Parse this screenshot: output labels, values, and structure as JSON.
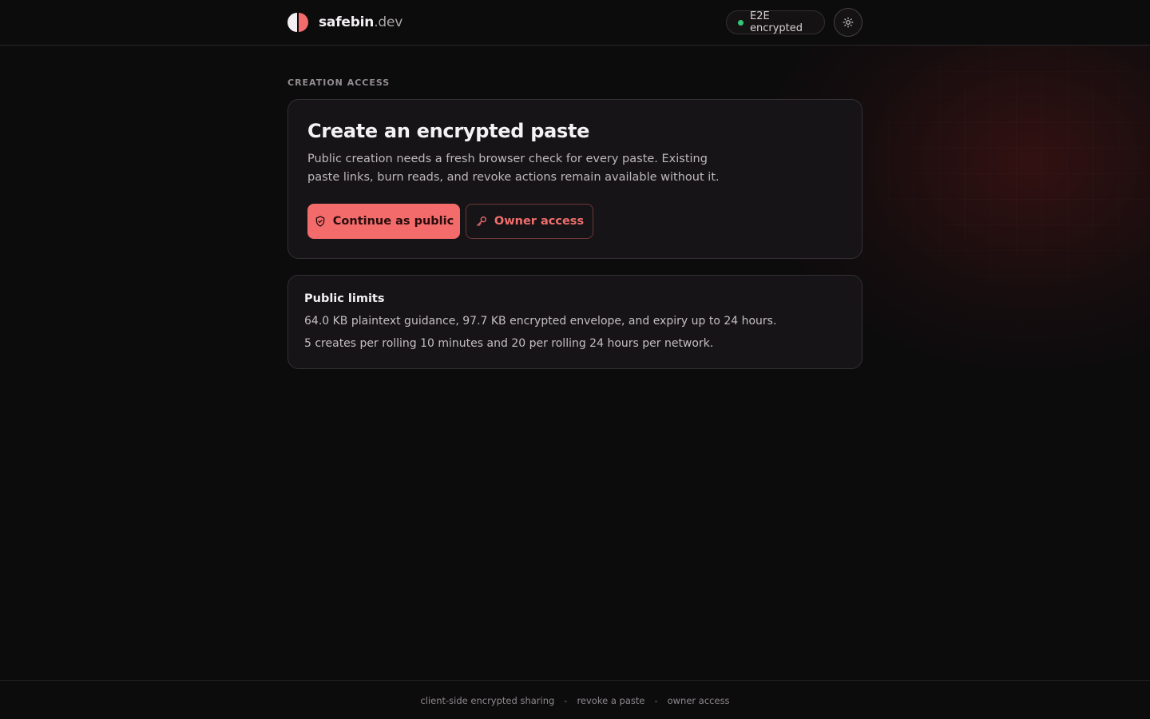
{
  "colors": {
    "background": "#0d0c0d",
    "accent": "#f36b6b",
    "status_ok": "#34c77b",
    "card": "#161416"
  },
  "header": {
    "brand_name": "safebin",
    "brand_tld": ".dev",
    "logo_icon": "half-circle-logo-icon",
    "badge_label": "E2E encrypted",
    "theme_toggle_icon": "sun-icon"
  },
  "main": {
    "section_label": "CREATION ACCESS",
    "create_card": {
      "title": "Create an encrypted paste",
      "description": "Public creation needs a fresh browser check for every paste. Existing paste links, burn reads, and revoke actions remain available without it.",
      "primary_button": {
        "label": "Continue as public",
        "icon": "shield-check-icon"
      },
      "secondary_button": {
        "label": "Owner access",
        "icon": "key-icon"
      }
    },
    "limits_card": {
      "title": "Public limits",
      "lines": [
        "64.0 KB plaintext guidance, 97.7 KB encrypted envelope, and expiry up to 24 hours.",
        "5 creates per rolling 10 minutes and 20 per rolling 24 hours per network."
      ]
    }
  },
  "footer": {
    "links": [
      "client-side encrypted sharing",
      "revoke a paste",
      "owner access"
    ],
    "separator": "-"
  }
}
